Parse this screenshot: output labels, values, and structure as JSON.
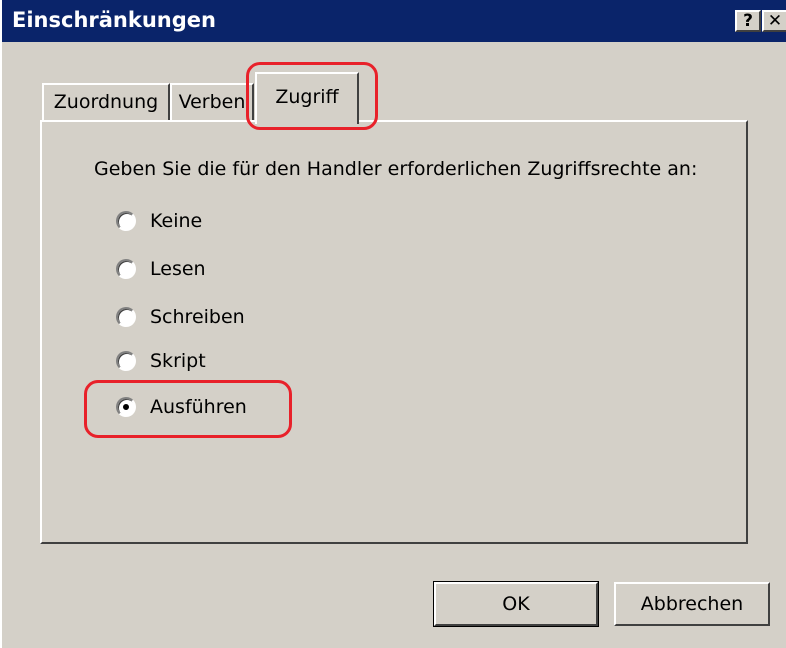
{
  "window": {
    "title": "Einschränkungen",
    "help_button": "?",
    "close_button": "✕"
  },
  "tabs": [
    {
      "label": "Zuordnung",
      "selected": false
    },
    {
      "label": "Verben",
      "selected": false
    },
    {
      "label": "Zugriff",
      "selected": true
    }
  ],
  "panel": {
    "instruction": "Geben Sie die für den Handler erforderlichen Zugriffsrechte an:",
    "options": [
      {
        "label": "Keine",
        "selected": false
      },
      {
        "label": "Lesen",
        "selected": false
      },
      {
        "label": "Schreiben",
        "selected": false
      },
      {
        "label": "Skript",
        "selected": false
      },
      {
        "label": "Ausführen",
        "selected": true
      }
    ]
  },
  "buttons": {
    "ok": "OK",
    "cancel": "Abbrechen"
  },
  "colors": {
    "titlebar": "#0a246a",
    "dialog_bg": "#d4d0c8",
    "highlight": "#e8212a"
  }
}
